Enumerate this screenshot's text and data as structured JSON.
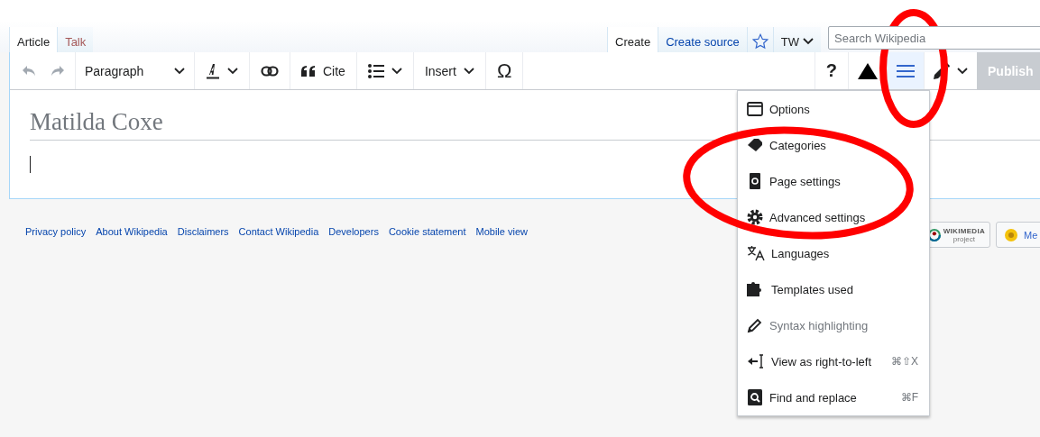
{
  "tabs_left": [
    {
      "label": "Article",
      "selected": true
    },
    {
      "label": "Talk",
      "selected": false
    }
  ],
  "tabs_right": [
    {
      "kind": "tab",
      "label": "Create",
      "selected": true
    },
    {
      "kind": "tab",
      "label": "Create source",
      "selected": false
    },
    {
      "kind": "star",
      "selected": false
    },
    {
      "kind": "dropdown",
      "label": "TW",
      "selected": false
    }
  ],
  "search": {
    "placeholder": "Search Wikipedia"
  },
  "toolbar": {
    "left": [
      {
        "kind": "undo",
        "disabled": true
      },
      {
        "kind": "redo",
        "disabled": true
      },
      {
        "kind": "dropdown",
        "label": "Paragraph"
      },
      {
        "kind": "style"
      },
      {
        "kind": "link"
      },
      {
        "kind": "cite",
        "label": "Cite"
      },
      {
        "kind": "list"
      },
      {
        "kind": "dropdown",
        "label": "Insert"
      },
      {
        "kind": "special",
        "label": "Ω"
      }
    ],
    "right": [
      {
        "kind": "help",
        "label": "?",
        "selected": false
      },
      {
        "kind": "notices",
        "selected": false
      },
      {
        "kind": "menu",
        "selected": true
      },
      {
        "kind": "edit-mode",
        "selected": false
      }
    ],
    "publish": {
      "label": "Publish",
      "disabled": true
    }
  },
  "page_title": "Matilda Coxe",
  "footer": {
    "links": [
      "Privacy policy",
      "About Wikipedia",
      "Disclaimers",
      "Contact Wikipedia",
      "Developers",
      "Cookie statement",
      "Mobile view"
    ],
    "badges": [
      {
        "kind": "wikimedia",
        "text": "WIKIMEDIA",
        "subtext": "project"
      },
      {
        "kind": "mediawiki",
        "text": "Me"
      }
    ]
  },
  "menu": {
    "items": [
      {
        "label": "Options",
        "disabled": false
      },
      {
        "label": "Categories",
        "disabled": false
      },
      {
        "label": "Page settings",
        "disabled": false
      },
      {
        "label": "Advanced settings",
        "disabled": false
      },
      {
        "label": "Languages",
        "disabled": false
      },
      {
        "label": "Templates used",
        "disabled": false
      },
      {
        "label": "Syntax highlighting",
        "disabled": true
      },
      {
        "label": "View as right-to-left",
        "shortcut": "⌘⇧X",
        "disabled": false
      },
      {
        "label": "Find and replace",
        "shortcut": "⌘F",
        "disabled": false
      }
    ]
  },
  "annotations": [
    {
      "kind": "ellipse"
    },
    {
      "kind": "ellipse"
    }
  ]
}
